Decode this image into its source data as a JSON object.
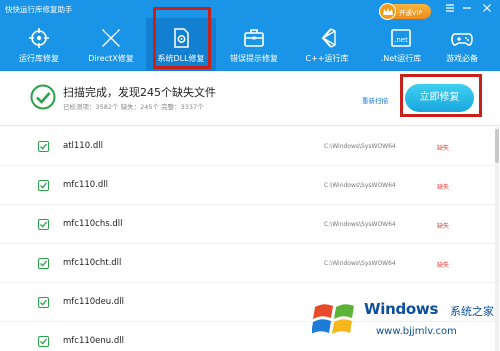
{
  "app": {
    "title": "快快运行库修复助手"
  },
  "vip": {
    "label": "开通VIP"
  },
  "nav": [
    {
      "label": "运行库修复",
      "icon": "target-icon"
    },
    {
      "label": "DirectX修复",
      "icon": "directx-icon"
    },
    {
      "label": "系统DLL修复",
      "icon": "dll-gear-icon",
      "active": true
    },
    {
      "label": "错误提示修复",
      "icon": "toolbox-icon"
    },
    {
      "label": "C++运行库",
      "icon": "cpp-icon"
    },
    {
      "label": ".Net运行库",
      "icon": "dotnet-icon"
    },
    {
      "label": "游戏必备",
      "icon": "gamepad-icon"
    }
  ],
  "summary": {
    "title": "扫描完成，发现245个缺失文件",
    "stats": "已检测项：3582个   缺失：245个   完整：3337个",
    "rescan": "重新扫描",
    "fix": "立即修复"
  },
  "files": [
    {
      "name": "atl110.dll",
      "path": "C:\\Windows\\SysWOW64",
      "status": "缺失"
    },
    {
      "name": "mfc110.dll",
      "path": "C:\\Windows\\SysWOW64",
      "status": "缺失"
    },
    {
      "name": "mfc110chs.dll",
      "path": "C:\\Windows\\SysWOW64",
      "status": "缺失"
    },
    {
      "name": "mfc110cht.dll",
      "path": "C:\\Windows\\SysWOW64",
      "status": "缺失"
    },
    {
      "name": "mfc110deu.dll",
      "path": "",
      "status": ""
    },
    {
      "name": "mfc110enu.dll",
      "path": "",
      "status": ""
    }
  ],
  "watermark": {
    "brand": "Windows",
    "cn": "系统之家",
    "url": "www.bjjmlv.com"
  },
  "colors": {
    "header": "#1a94e6",
    "accent": "#1aa6de",
    "missing": "#e03a2a",
    "check": "#2aa24a",
    "highlight": "#c8201b"
  }
}
